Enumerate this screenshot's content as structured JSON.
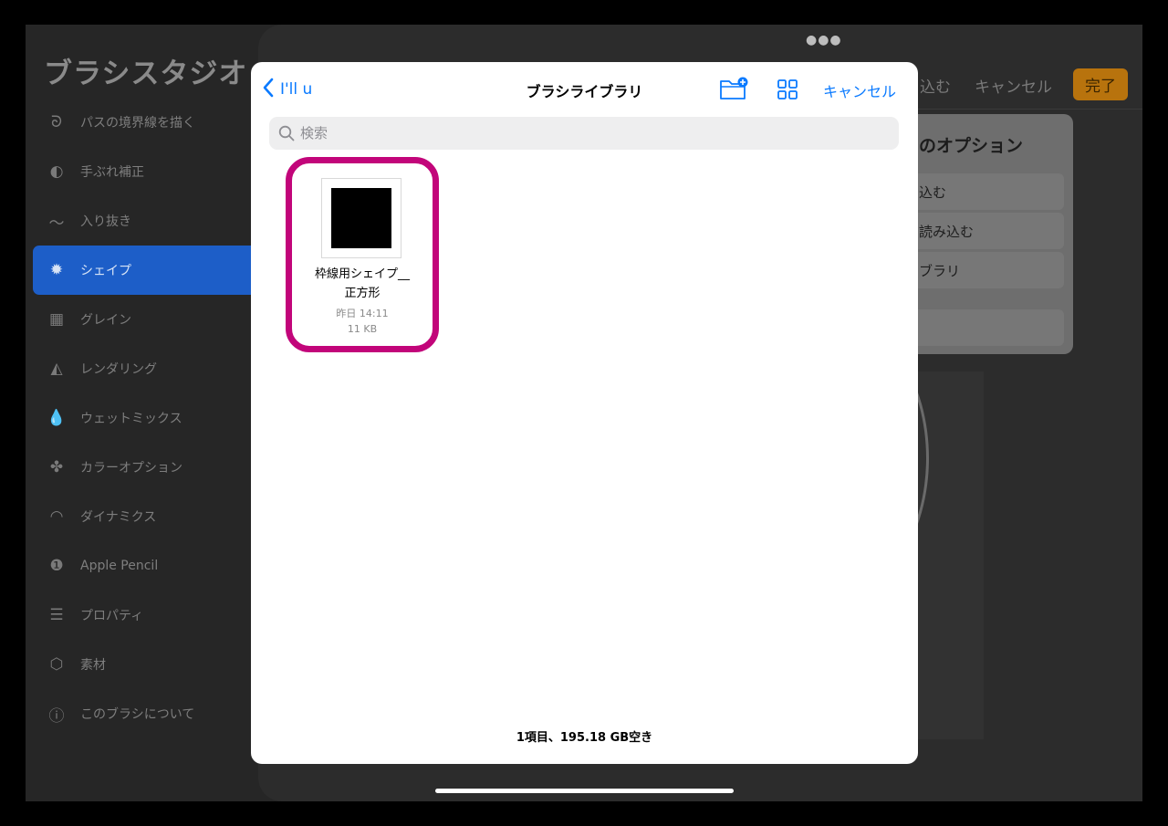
{
  "studio": {
    "title": "ブラシスタジオ",
    "items": [
      {
        "label": "パスの境界線を描く",
        "icon": "stroke-path-icon",
        "glyph": "ᘐ"
      },
      {
        "label": "手ぶれ補正",
        "icon": "stabilization-icon",
        "glyph": "◐"
      },
      {
        "label": "入り抜き",
        "icon": "taper-icon",
        "glyph": "〜"
      },
      {
        "label": "シェイプ",
        "icon": "shape-icon",
        "glyph": "✹",
        "active": true
      },
      {
        "label": "グレイン",
        "icon": "grain-icon",
        "glyph": "▦"
      },
      {
        "label": "レンダリング",
        "icon": "rendering-icon",
        "glyph": "◭"
      },
      {
        "label": "ウェットミックス",
        "icon": "wet-mix-icon",
        "glyph": "💧"
      },
      {
        "label": "カラーオプション",
        "icon": "color-dynamics-icon",
        "glyph": "✤"
      },
      {
        "label": "ダイナミクス",
        "icon": "dynamics-icon",
        "glyph": "◠"
      },
      {
        "label": "Apple Pencil",
        "icon": "apple-pencil-icon",
        "glyph": "❶"
      },
      {
        "label": "プロパティ",
        "icon": "properties-icon",
        "glyph": "☰"
      },
      {
        "label": "素材",
        "icon": "materials-icon",
        "glyph": "⬡"
      },
      {
        "label": "このブラシについて",
        "icon": "about-brush-icon",
        "glyph": "ⓘ"
      }
    ]
  },
  "background": {
    "import_label": "込む",
    "cancel_label": "キャンセル",
    "done_label": "完了",
    "popover_title": "のオプション",
    "popover_items": [
      "込む",
      "読み込む",
      "ブラリ",
      ""
    ]
  },
  "modal": {
    "back_label": "I'll u",
    "title": "ブラシライブラリ",
    "cancel_label": "キャンセル",
    "search_placeholder": "検索",
    "file": {
      "name_line1": "枠線用シェイプ__",
      "name_line2": "正方形",
      "date": "昨日 14:11",
      "size": "11 KB"
    },
    "footer": "1項目、195.18 GB空き"
  },
  "colors": {
    "accent": "#0a7aff",
    "highlight": "#c2057a",
    "done": "#b8730d",
    "active_item": "#1d5ec8"
  }
}
